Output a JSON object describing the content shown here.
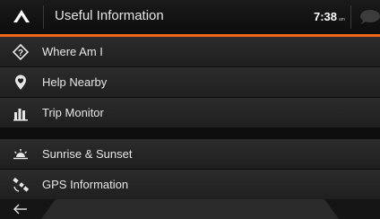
{
  "header": {
    "title": "Useful Information",
    "time": "7:38",
    "ampm": "am",
    "up_icon": "up-arrow-icon",
    "message_icon": "speech-bubble-icon"
  },
  "accent_color": "#f0641e",
  "menu": {
    "items": [
      {
        "label": "Where Am I",
        "icon": "question-location-icon"
      },
      {
        "label": "Help Nearby",
        "icon": "pin-heart-icon"
      },
      {
        "label": "Trip Monitor",
        "icon": "bar-chart-icon"
      },
      {
        "label": "Sunrise & Sunset",
        "icon": "sunrise-icon"
      },
      {
        "label": "GPS Information",
        "icon": "satellite-icon"
      }
    ]
  },
  "footer": {
    "back_icon": "back-arrow-icon"
  }
}
